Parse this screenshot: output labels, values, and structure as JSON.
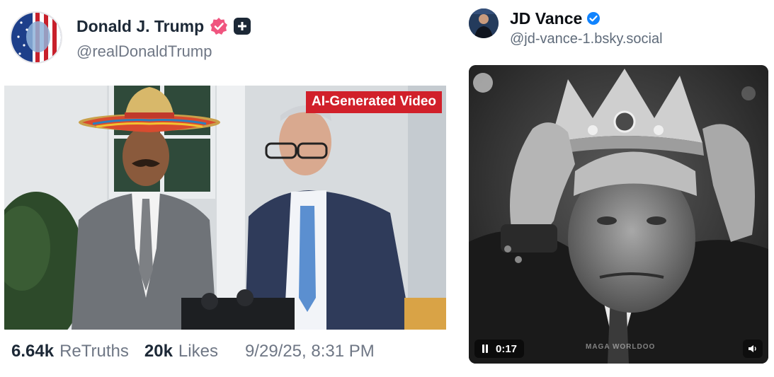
{
  "left_post": {
    "author_name": "Donald J. Trump",
    "handle": "@realDonaldTrump",
    "media_label": "AI-Generated Video",
    "stats": {
      "retruths_count": "6.64k",
      "retruths_label": "ReTruths",
      "likes_count": "20k",
      "likes_label": "Likes",
      "timestamp": "9/29/25, 8:31 PM"
    },
    "icons": [
      "verified-badge-icon",
      "truth-plus-icon"
    ],
    "colors": {
      "verified": "#f0557f",
      "ai_label": "#d1202a",
      "name": "#1c2836",
      "muted": "#6f7785"
    }
  },
  "right_post": {
    "author_name": "JD Vance",
    "handle": "@jd-vance-1.bsky.social",
    "video": {
      "time": "0:17",
      "watermark": "MAGA WORLDOO"
    },
    "icons": [
      "verified-check-icon",
      "pause-icon",
      "volume-icon"
    ],
    "colors": {
      "verified": "#1083fe",
      "handle": "#5f6b7a"
    }
  }
}
